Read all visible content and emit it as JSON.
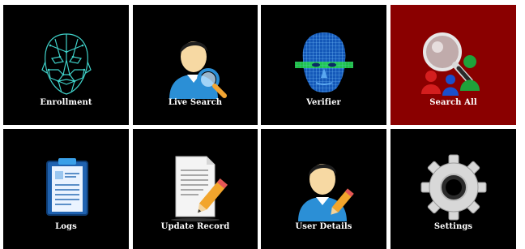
{
  "tiles": [
    {
      "label": "Enrollment",
      "icon": "face-mesh-icon",
      "active": false
    },
    {
      "label": "Live Search",
      "icon": "user-search-icon",
      "active": false
    },
    {
      "label": "Verifier",
      "icon": "face-scan-icon",
      "active": false
    },
    {
      "label": "Search All",
      "icon": "magnifier-group-icon",
      "active": true
    },
    {
      "label": "Logs",
      "icon": "clipboard-icon",
      "active": false
    },
    {
      "label": "Update Record",
      "icon": "document-edit-icon",
      "active": false
    },
    {
      "label": "User Details",
      "icon": "user-edit-icon",
      "active": false
    },
    {
      "label": "Settings",
      "icon": "gear-icon",
      "active": false
    }
  ],
  "colors": {
    "tile_bg": "#000000",
    "active_tile_bg": "#8a0000",
    "label": "#ffffff"
  }
}
